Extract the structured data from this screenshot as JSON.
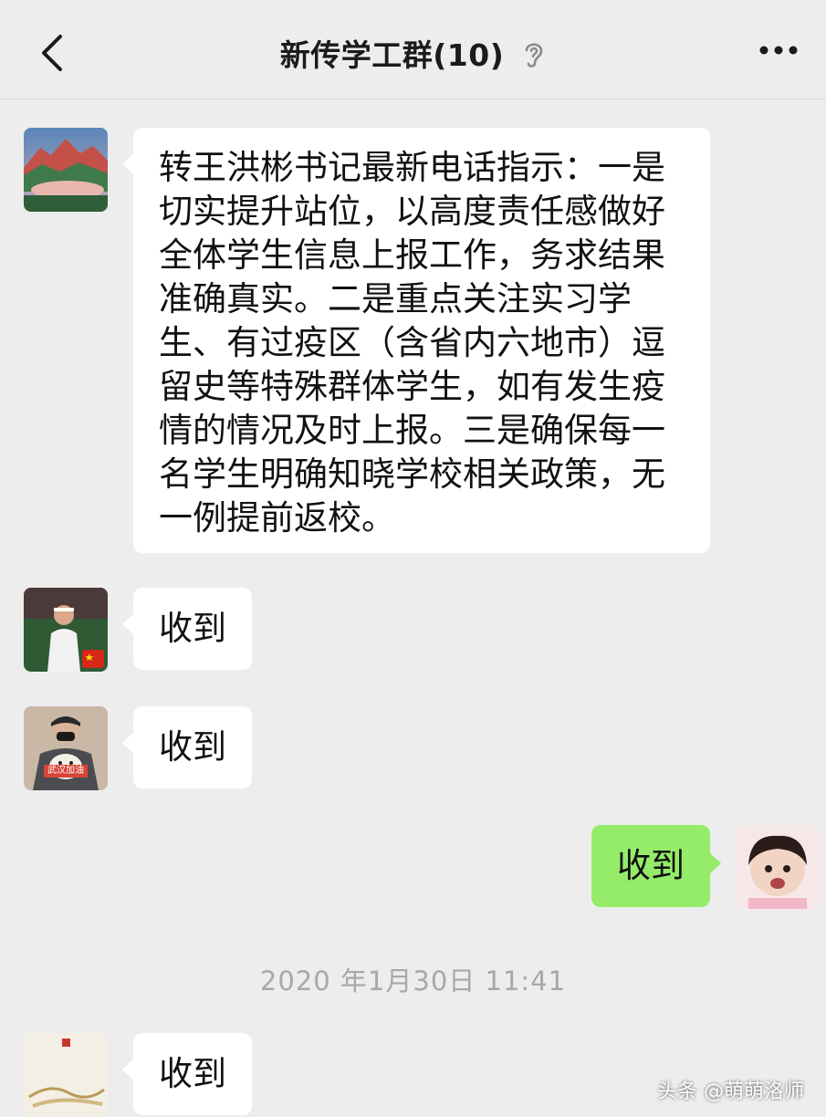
{
  "header": {
    "title": "新传学工群(10)",
    "back_icon": "chevron-left-icon",
    "mute_icon": "ear-icon",
    "more_icon": "more-dots-icon"
  },
  "messages": [
    {
      "sender": "left",
      "text": "转王洪彬书记最新电话指示：一是\n切实提升站位，以高度责任感做好\n全体学生信息上报工作，务求结果\n准确真实。二是重点关注实习学\n生、有过疫区（含省内六地市）逗\n留史等特殊群体学生，如有发生疫\n情的情况及时上报。三是确保每一\n名学生明确知晓学校相关政策，无\n一例提前返校。"
    },
    {
      "sender": "left",
      "text": "收到"
    },
    {
      "sender": "left",
      "text": "收到",
      "avatar_caption": "武汉加油"
    },
    {
      "sender": "right",
      "text": "收到"
    },
    {
      "sender": "left",
      "text": "收到"
    }
  ],
  "timestamp": "2020 年1月30日 11:41",
  "watermark": "头条 @萌萌洛师",
  "colors": {
    "background": "#ededed",
    "bubble_incoming": "#ffffff",
    "bubble_outgoing": "#95ec69",
    "timestamp_text": "#a8a8a8"
  }
}
